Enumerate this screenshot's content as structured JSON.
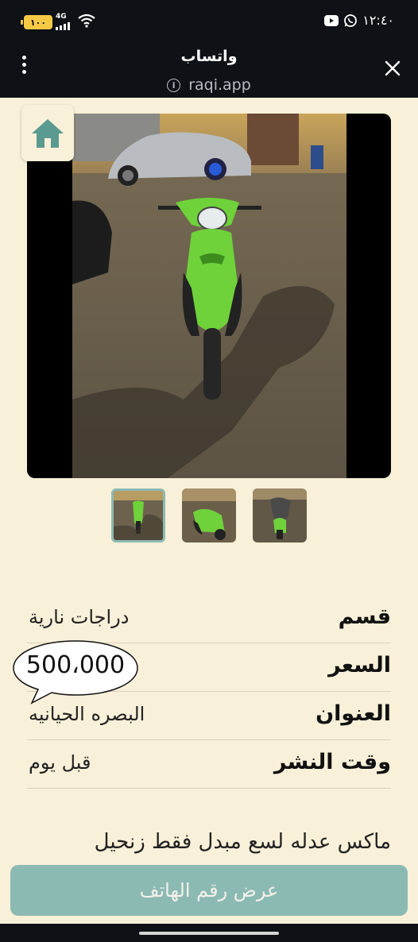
{
  "status_bar": {
    "battery": "١٠٠",
    "network": "4G",
    "time": "١٢:٤٠"
  },
  "browser": {
    "title": "واتساب",
    "url": "raqi.app",
    "menu_icon": "more-vertical-icon",
    "close_icon": "close-icon",
    "info_icon": "info-icon"
  },
  "gallery": {
    "home_icon": "home-icon",
    "thumbnail_count": 3,
    "selected_index": 0
  },
  "details": [
    {
      "label": "قسم",
      "value": "دراجات نارية"
    },
    {
      "label": "السعر",
      "value": ""
    },
    {
      "label": "العنوان",
      "value": "البصره الحيانيه"
    },
    {
      "label": "وقت النشر",
      "value": "قبل يوم"
    }
  ],
  "price": "500،000",
  "description": "ماكس عدله لسع مبدل فقط زنحيل",
  "phone_button_label": "عرض رقم الهاتف",
  "colors": {
    "background": "#f8f0d8",
    "accent": "#8bbab3",
    "bar": "#0e1116"
  }
}
